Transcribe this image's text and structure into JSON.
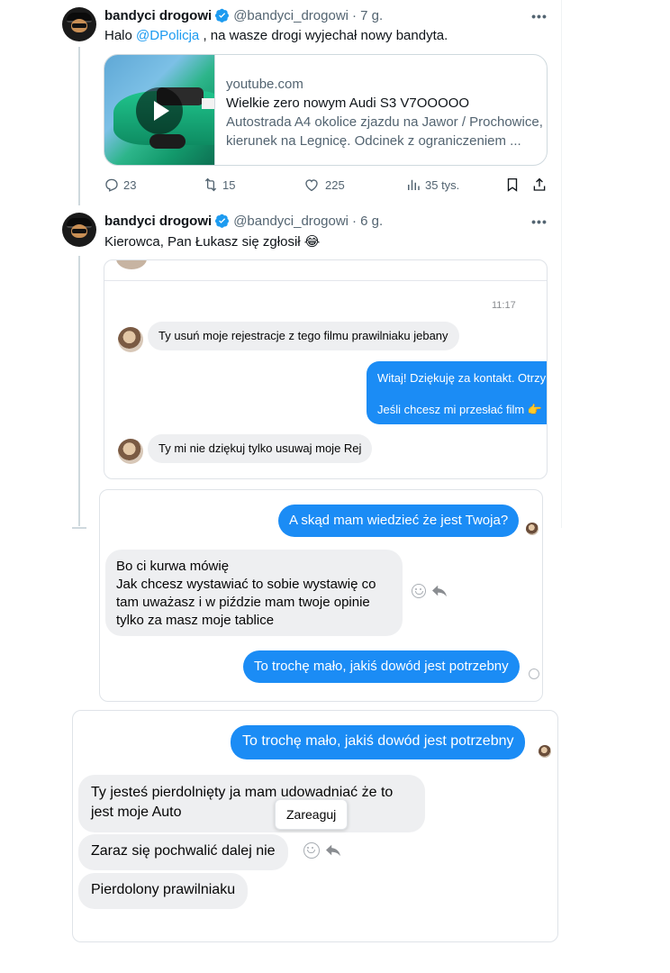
{
  "tweets": [
    {
      "name": "bandyci drogowi",
      "handle": "@bandyci_drogowi",
      "time": "· 7 g.",
      "text_before": "Halo ",
      "mention": "@DPolicja",
      "text_after": " , na wasze drogi wyjechał nowy bandyta.",
      "card": {
        "domain": "youtube.com",
        "title": "Wielkie zero nowym Audi S3 V7OOOOO",
        "desc_line1": "Autostrada A4 okolice zjazdu na Jawor / Prochowice,",
        "desc_line2": "kierunek na Legnicę. Odcinek z ograniczeniem ..."
      },
      "stats": {
        "replies": "23",
        "reposts": "15",
        "likes": "225",
        "views": "35 tys."
      }
    },
    {
      "name": "bandyci drogowi",
      "handle": "@bandyci_drogowi",
      "time": "· 6 g.",
      "text": "Kierowca, Pan Łukasz się zgłosił 😂"
    }
  ],
  "chat1": {
    "time": "11:17",
    "msg1": "Ty usuń moje rejestracje z tego filmu prawilniaku  jebany",
    "out_line1": "Witaj! Dziękuję za kontakt. Otrzy",
    "out_line2": "Jeśli chcesz mi przesłać film 👉",
    "msg2": "Ty mi nie dziękuj tylko usuwaj moje Rej"
  },
  "chat2": {
    "out1": "A skąd mam wiedzieć że jest Twoja?",
    "in_lines": [
      "Bo ci kurwa mówię",
      "Jak chcesz wystawiać to sobie wystawię co",
      "tam uważasz i w piździe mam twoje opinie",
      "tylko za masz moje tablice"
    ],
    "out2": "To trochę mało, jakiś dowód jest potrzebny"
  },
  "chat3": {
    "out1": "To trochę mało, jakiś dowód jest potrzebny",
    "in1_line1": "Ty jesteś pierdolnięty ja mam udowadniać że to",
    "in1_line2": "jest moje Auto",
    "tooltip": "Zareaguj",
    "in2": "Zaraz się pochwalić dalej nie",
    "in3": "Pierdolony prawilniaku"
  },
  "colors": {
    "messenger_blue": "#1b8cf5",
    "twitter_blue": "#1d9bf0",
    "bubble_gray": "#eeeff1"
  },
  "icons": [
    "more-icon",
    "verified-icon",
    "play-icon",
    "reply-icon",
    "repost-icon",
    "like-icon",
    "views-icon",
    "bookmark-icon",
    "share-icon",
    "smile-icon",
    "reply-arrow-icon"
  ]
}
